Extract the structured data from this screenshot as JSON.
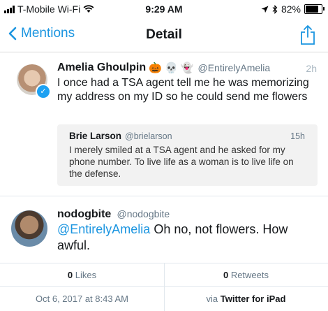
{
  "status_bar": {
    "carrier": "T-Mobile Wi-Fi",
    "time": "9:29 AM",
    "battery": "82%",
    "battery_level": 0.82
  },
  "nav": {
    "back_label": "Mentions",
    "title": "Detail"
  },
  "tweet": {
    "name": "Amelia Ghoulpin",
    "emojis": "🎃 💀 👻",
    "handle": "@EntirelyAmelia",
    "time": "2h",
    "text": "I once had a TSA agent tell me he was memorizing my address on my ID so he could send me flowers",
    "quote": {
      "name": "Brie Larson",
      "handle": "@brielarson",
      "time": "15h",
      "text": "I merely smiled at a TSA agent and he asked for my phone number. To live life as a woman is to live life on the defense."
    }
  },
  "reply": {
    "name": "nodogbite",
    "handle": "@nodogbite",
    "mention": "@EntirelyAmelia",
    "text": " Oh no, not flowers.  How awful."
  },
  "stats": {
    "likes_count": "0",
    "likes_label": " Likes",
    "retweets_count": "0",
    "retweets_label": " Retweets"
  },
  "meta": {
    "date": "Oct 6, 2017 at 8:43 AM",
    "via_prefix": "via ",
    "via_app": "Twitter for iPad"
  },
  "colors": {
    "accent": "#1b95e0",
    "verified": "#1da1f2"
  }
}
